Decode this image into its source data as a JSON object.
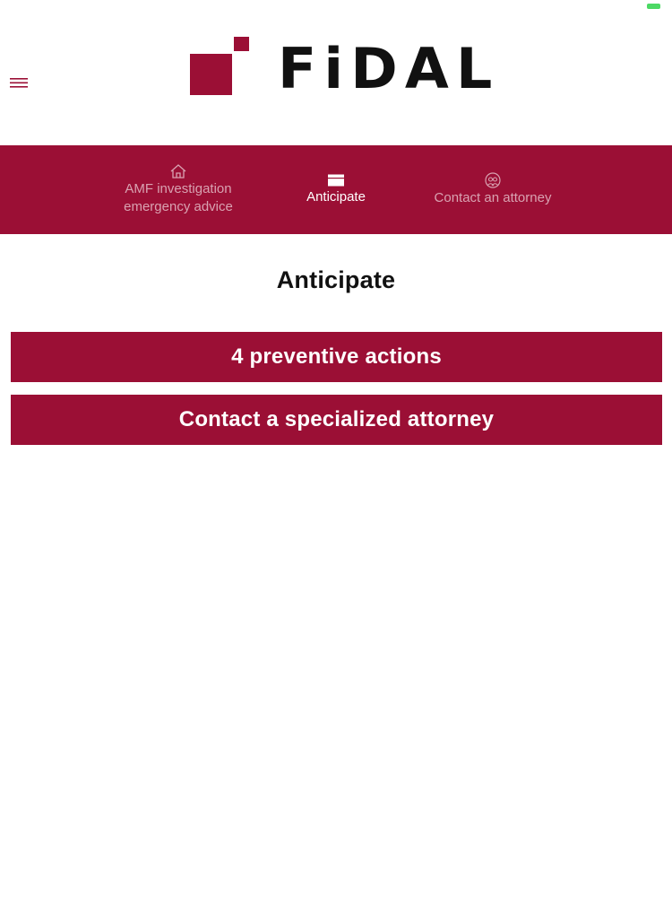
{
  "colors": {
    "brand": "#9b0f35",
    "tab_text_inactive": "#d9a2b1",
    "tab_text_active": "#ffffff",
    "status_battery": "#4cd964"
  },
  "header": {
    "brand_name": "FiDAL",
    "menu_icon": "hamburger-menu-icon"
  },
  "tabs": [
    {
      "label": "AMF investigation\nemergency advice",
      "icon": "house-icon",
      "active": false
    },
    {
      "label": "Anticipate",
      "icon": "calendar-icon",
      "active": true
    },
    {
      "label": "Contact an attorney",
      "icon": "people-icon",
      "active": false
    }
  ],
  "main": {
    "title": "Anticipate",
    "buttons": [
      {
        "label": "4 preventive actions"
      },
      {
        "label": "Contact a specialized attorney"
      }
    ]
  }
}
